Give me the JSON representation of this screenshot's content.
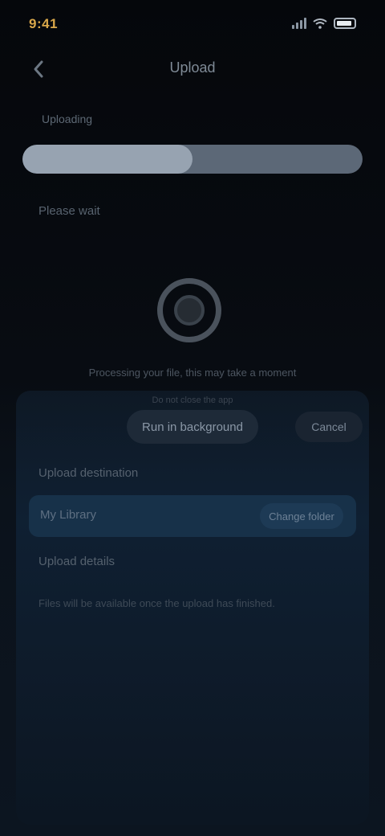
{
  "status_bar": {
    "time": "9:41"
  },
  "header": {
    "title": "Upload",
    "back_icon": "chevron-left-icon"
  },
  "progress": {
    "step_label": "Uploading",
    "fraction": 0.5,
    "status_text": "Please wait"
  },
  "center": {
    "avatar_icon": "spinner-icon",
    "caption": "Processing your file, this may take a moment",
    "sub_caption": "Do not close the app"
  },
  "actions": {
    "primary_label": "Run in background",
    "secondary_label": "Cancel"
  },
  "panel": {
    "section_label": "Upload destination",
    "option_label": "My Library",
    "option_chip": "Change folder",
    "section_label_2": "Upload details",
    "body_text": "Files will be available once the upload has finished."
  },
  "colors": {
    "accent_time": "#d9a74a",
    "progress_fill": "#97a3b1",
    "progress_track": "#5c6877"
  }
}
